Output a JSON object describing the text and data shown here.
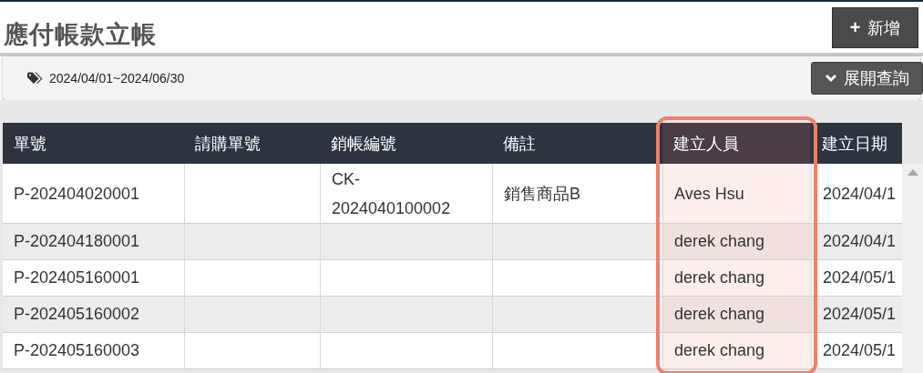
{
  "page_title": "應付帳款立帳",
  "add_button": {
    "icon": "+",
    "label": "新增"
  },
  "filter": {
    "tag": "2024/04/01~2024/06/30",
    "expand_button": "展開查詢"
  },
  "table": {
    "columns": [
      {
        "label": "單號",
        "highlighted": false
      },
      {
        "label": "請購單號",
        "highlighted": false
      },
      {
        "label": "銷帳編號",
        "highlighted": false
      },
      {
        "label": "備註",
        "highlighted": false
      },
      {
        "label": "建立人員",
        "highlighted": true
      },
      {
        "label": "建立日期",
        "highlighted": false
      }
    ],
    "rows": [
      [
        "P-202404020001",
        "",
        "CK-2024040100002",
        "銷售商品B",
        "Aves Hsu",
        "2024/04/1"
      ],
      [
        "P-202404180001",
        "",
        "",
        "",
        "derek chang",
        "2024/04/1"
      ],
      [
        "P-202405160001",
        "",
        "",
        "",
        "derek chang",
        "2024/05/1"
      ],
      [
        "P-202405160002",
        "",
        "",
        "",
        "derek chang",
        "2024/05/1"
      ],
      [
        "P-202405160003",
        "",
        "",
        "",
        "derek chang",
        "2024/05/1"
      ]
    ]
  }
}
